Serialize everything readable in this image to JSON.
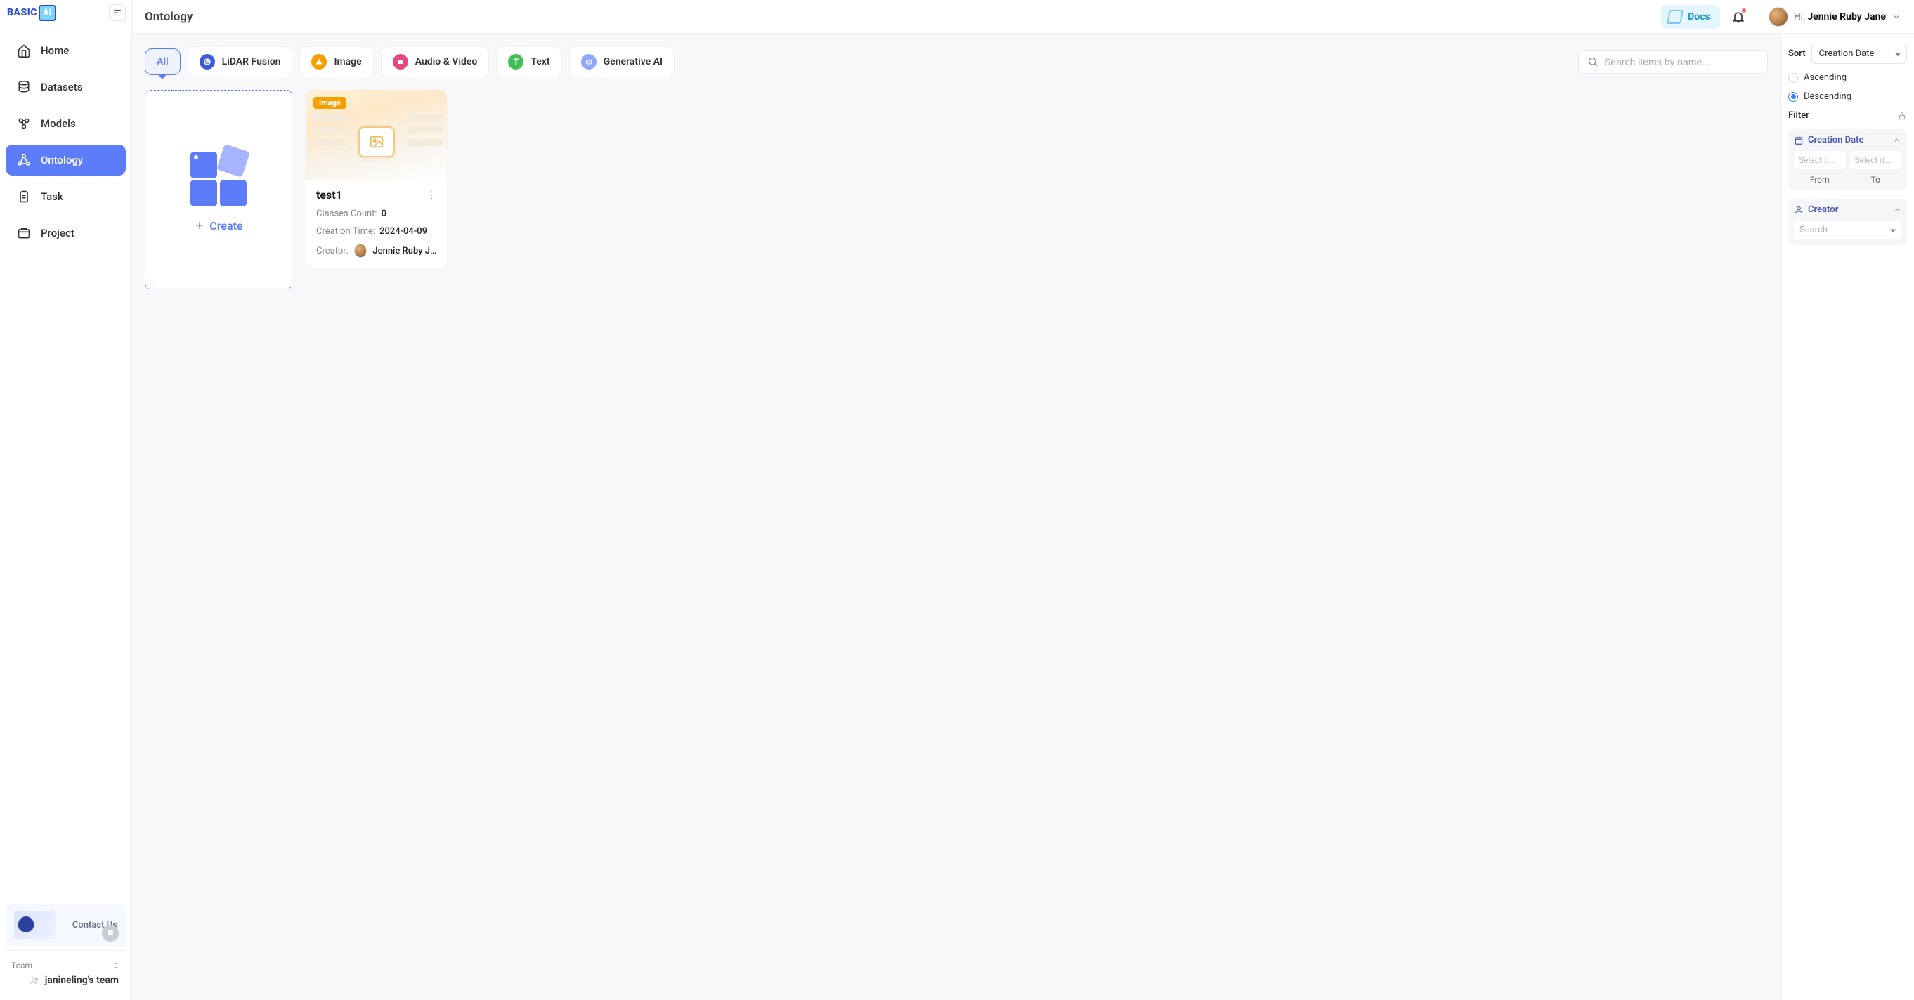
{
  "brand": {
    "text": "BASIC",
    "suffix": "AI"
  },
  "page_title": "Ontology",
  "topbar": {
    "docs_label": "Docs",
    "user_greeting": "Hi, ",
    "user_name": "Jennie Ruby Jane"
  },
  "sidebar": {
    "items": [
      {
        "label": "Home",
        "icon": "home-icon"
      },
      {
        "label": "Datasets",
        "icon": "datasets-icon"
      },
      {
        "label": "Models",
        "icon": "models-icon"
      },
      {
        "label": "Ontology",
        "icon": "ontology-icon",
        "active": true
      },
      {
        "label": "Task",
        "icon": "task-icon"
      },
      {
        "label": "Project",
        "icon": "project-icon"
      }
    ],
    "contact_label": "Contact Us",
    "team_label": "Team",
    "team_name": "janineling's team"
  },
  "filters": {
    "all_label": "All",
    "types": [
      {
        "label": "LiDAR Fusion",
        "icon": "lidar"
      },
      {
        "label": "Image",
        "icon": "image"
      },
      {
        "label": "Audio & Video",
        "icon": "av"
      },
      {
        "label": "Text",
        "icon": "text"
      },
      {
        "label": "Generative AI",
        "icon": "gen"
      }
    ],
    "search_placeholder": "Search items by name..."
  },
  "create_label": "Create",
  "ontologies": [
    {
      "badge": "Image",
      "title": "test1",
      "classes_label": "Classes Count:",
      "classes_value": "0",
      "time_label": "Creation Time:",
      "time_value": "2024-04-09",
      "creator_label": "Creator:",
      "creator_value": "Jennie Ruby Ja..."
    }
  ],
  "rightpanel": {
    "sort_label": "Sort",
    "sort_value": "Creation Date",
    "asc_label": "Ascending",
    "desc_label": "Descending",
    "filter_label": "Filter",
    "creation_date_label": "Creation Date",
    "date_placeholder": "Select d...",
    "from_label": "From",
    "to_label": "To",
    "creator_label": "Creator",
    "creator_search_placeholder": "Search"
  }
}
